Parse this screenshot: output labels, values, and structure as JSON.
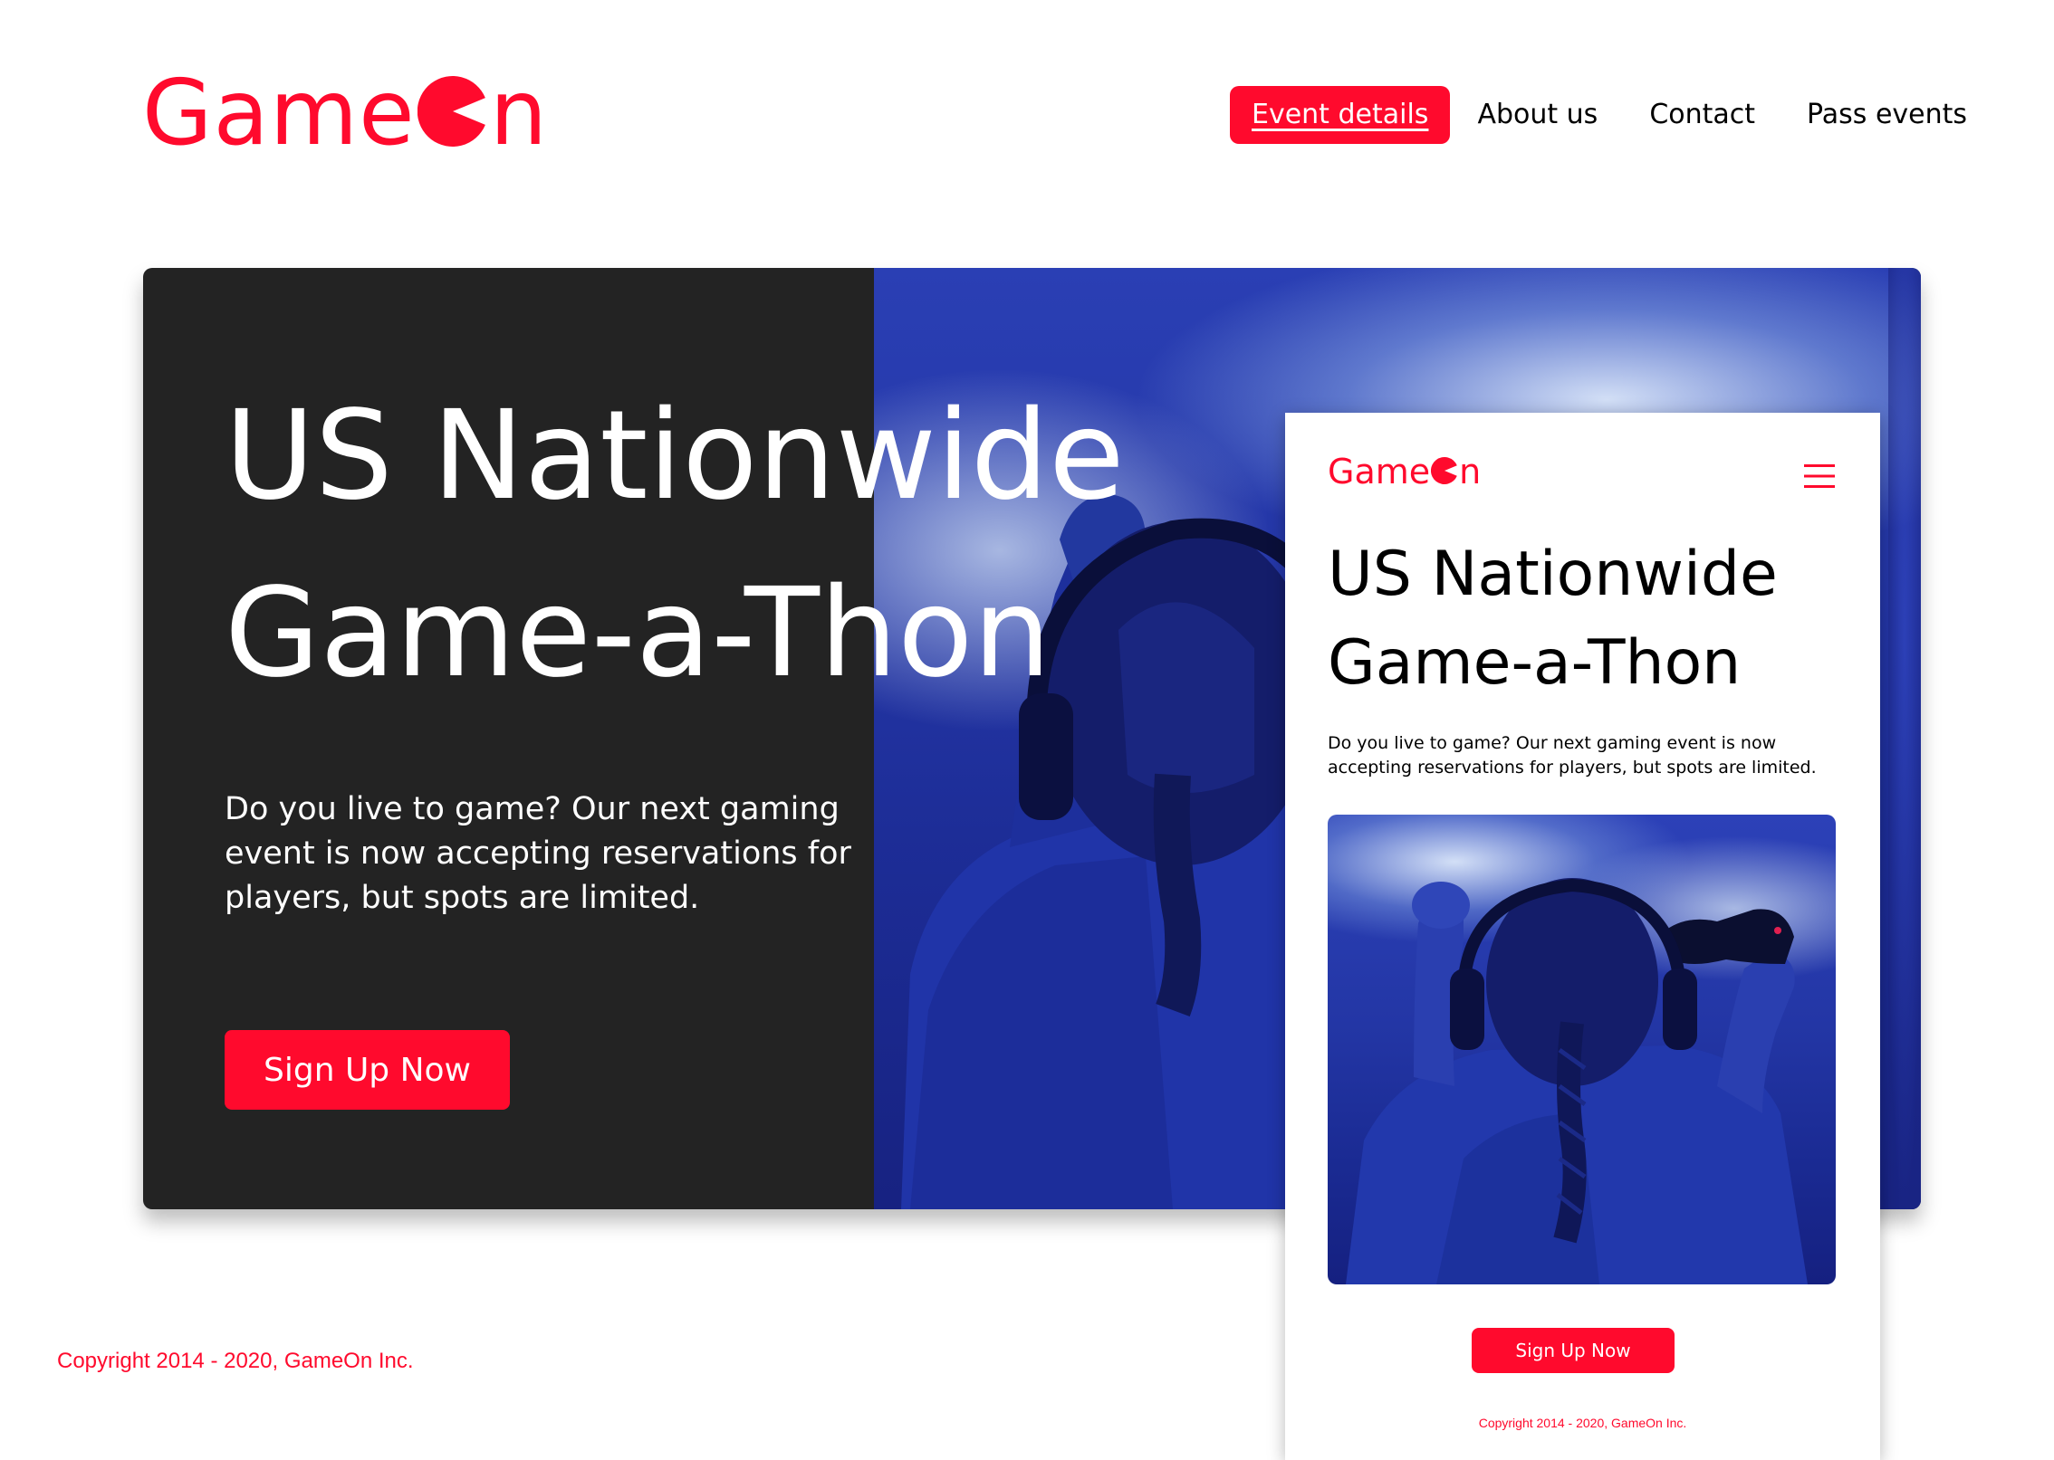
{
  "brand": {
    "name_prefix": "Game",
    "name_suffix": "n",
    "logo_icon": "pacman-o-icon",
    "accent_color": "#ff0a2d"
  },
  "nav": {
    "items": [
      {
        "label": "Event details",
        "active": true
      },
      {
        "label": "About us",
        "active": false
      },
      {
        "label": "Contact",
        "active": false
      },
      {
        "label": "Pass events",
        "active": false
      }
    ]
  },
  "hero": {
    "title_line1": "US Nationwide",
    "title_line2": "Game-a-Thon",
    "subtitle": "Do you live to game? Our next gaming event is now accepting reservations for players, but spots are limited.",
    "cta_label": "Sign Up Now",
    "background_color": "#232323",
    "image": "gamer-with-headphones-and-controller-photo"
  },
  "footer": {
    "copyright": "Copyright 2014 - 2020, GameOn Inc."
  },
  "mobile": {
    "menu_icon": "hamburger-menu-icon",
    "title_line1": "US Nationwide",
    "title_line2": "Game-a-Thon",
    "subtitle": "Do you live to game? Our next gaming event is now accepting reservations for players, but spots are limited.",
    "cta_label": "Sign Up Now",
    "copyright": "Copyright 2014 - 2020, GameOn Inc."
  }
}
